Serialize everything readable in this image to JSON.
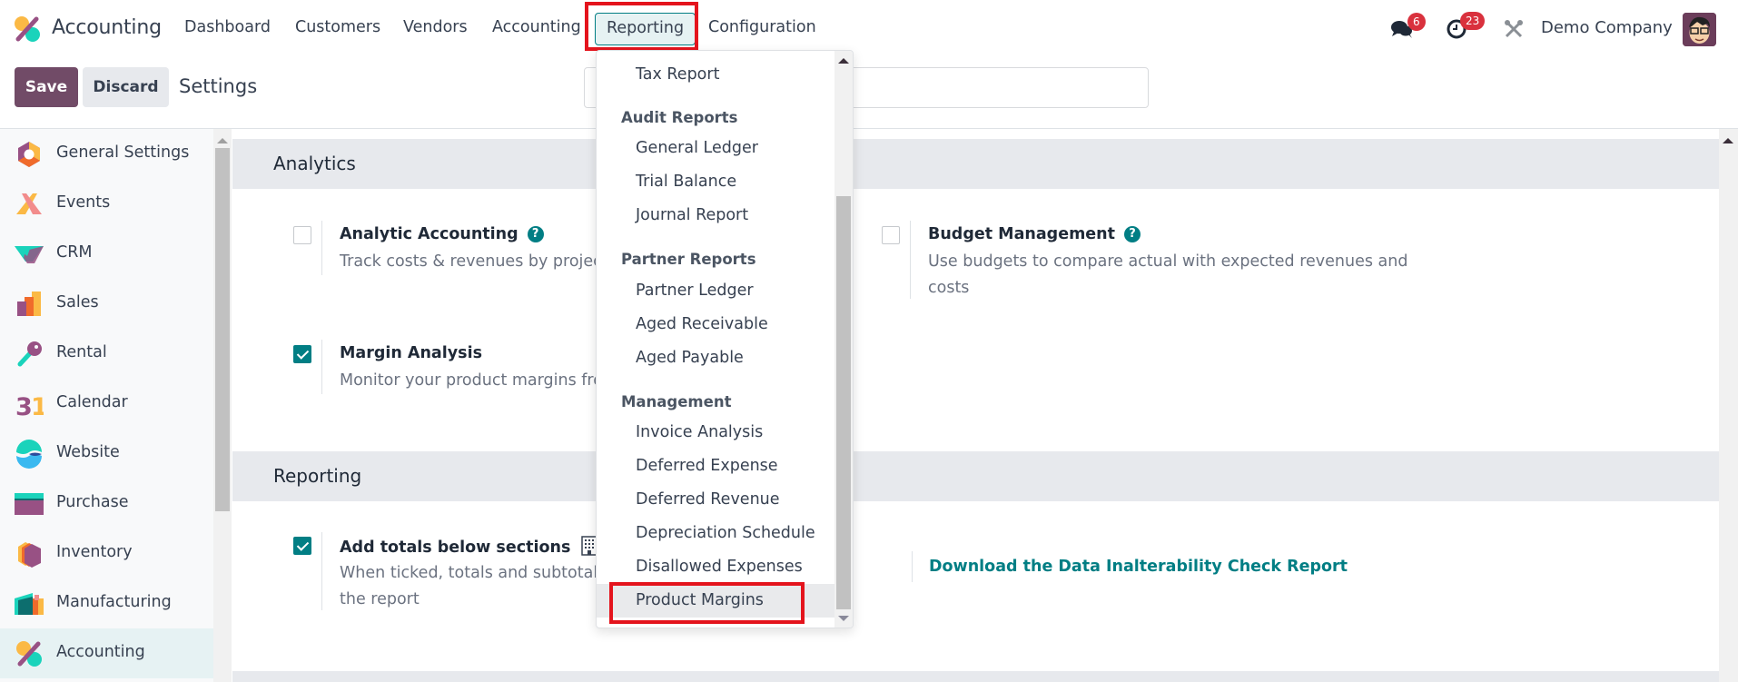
{
  "navbar": {
    "app_name": "Accounting",
    "menus": [
      "Dashboard",
      "Customers",
      "Vendors",
      "Accounting",
      "Reporting",
      "Configuration"
    ],
    "active_menu": "Reporting",
    "messages_badge": "6",
    "activities_badge": "23",
    "company": "Demo Company"
  },
  "control_panel": {
    "save_label": "Save",
    "discard_label": "Discard",
    "title": "Settings",
    "search_value": ""
  },
  "sidebar": {
    "items": [
      {
        "label": "General Settings",
        "icon": "general-settings-icon"
      },
      {
        "label": "Events",
        "icon": "events-icon"
      },
      {
        "label": "CRM",
        "icon": "crm-icon"
      },
      {
        "label": "Sales",
        "icon": "sales-icon"
      },
      {
        "label": "Rental",
        "icon": "rental-icon"
      },
      {
        "label": "Calendar",
        "icon": "calendar-icon"
      },
      {
        "label": "Website",
        "icon": "website-icon"
      },
      {
        "label": "Purchase",
        "icon": "purchase-icon"
      },
      {
        "label": "Inventory",
        "icon": "inventory-icon"
      },
      {
        "label": "Manufacturing",
        "icon": "manufacturing-icon"
      },
      {
        "label": "Accounting",
        "icon": "accounting-icon",
        "active": true
      }
    ]
  },
  "main": {
    "analytics": {
      "header": "Analytics",
      "analytic_accounting": {
        "title": "Analytic Accounting",
        "desc": "Track costs & revenues by project",
        "checked": false
      },
      "budget_management": {
        "title": "Budget Management",
        "desc": "Use budgets to compare actual with expected revenues and costs",
        "checked": false
      },
      "margin_analysis": {
        "title": "Margin Analysis",
        "desc": "Monitor your product margins fro",
        "checked": true
      }
    },
    "reporting": {
      "header": "Reporting",
      "add_totals": {
        "title": "Add totals below sections",
        "desc": "When ticked, totals and subtotals",
        "desc2": "the report",
        "checked": true
      },
      "download_link": "Download the Data Inalterability Check Report"
    }
  },
  "dropdown": {
    "top_item": "Tax Report",
    "groups": [
      {
        "header": "Audit Reports",
        "items": [
          "General Ledger",
          "Trial Balance",
          "Journal Report"
        ]
      },
      {
        "header": "Partner Reports",
        "items": [
          "Partner Ledger",
          "Aged Receivable",
          "Aged Payable"
        ]
      },
      {
        "header": "Management",
        "items": [
          "Invoice Analysis",
          "Deferred Expense",
          "Deferred Revenue",
          "Depreciation Schedule",
          "Disallowed Expenses",
          "Product Margins"
        ]
      }
    ],
    "highlighted_item": "Product Margins"
  },
  "colors": {
    "brand": "#714b67",
    "accent": "#017e84",
    "badge": "#d9313d",
    "highlight_box": "#e4141d"
  }
}
